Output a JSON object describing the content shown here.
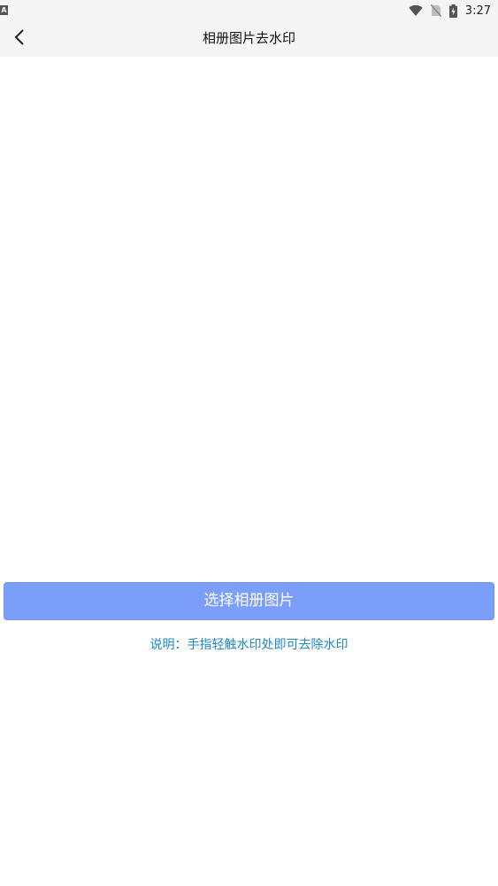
{
  "status_bar": {
    "time": "3:27",
    "left_icon": "A"
  },
  "nav": {
    "title": "相册图片去水印"
  },
  "actions": {
    "select_button_label": "选择相册图片"
  },
  "hint": {
    "text": "说明：手指轻触水印处即可去除水印"
  },
  "colors": {
    "button_bg": "#7b9efb",
    "hint_text": "#1e88c8",
    "nav_bg": "#f5f5f5"
  },
  "icons": {
    "back": "back-arrow-icon",
    "wifi": "wifi-icon",
    "sim": "no-sim-icon",
    "battery": "battery-charging-icon"
  }
}
